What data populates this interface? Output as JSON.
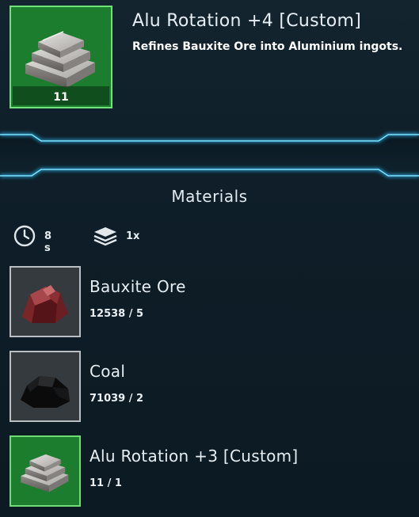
{
  "item": {
    "title": "Alu Rotation +4 [Custom]",
    "description": "Refines Bauxite Ore into Aluminium ingots.",
    "quantity": "11",
    "icon": "aluminium-ingots-icon",
    "frame_color": "#1d7d2f"
  },
  "materials": {
    "title": "Materials",
    "stats": {
      "time": "8 s",
      "time_icon": "clock-icon",
      "stack": "1x",
      "stack_icon": "layers-icon"
    },
    "items": [
      {
        "name": "Bauxite Ore",
        "count": "12538 / 5",
        "icon": "bauxite-ore-icon",
        "frame": "gray"
      },
      {
        "name": "Coal",
        "count": "71039 / 2",
        "icon": "coal-icon",
        "frame": "gray"
      },
      {
        "name": "Alu Rotation +3 [Custom]",
        "count": "11 / 1",
        "icon": "aluminium-ingots-icon",
        "frame": "green"
      }
    ]
  },
  "colors": {
    "accent_glow": "#2bc6ff",
    "rarity_green": "#1d7d2f",
    "background": "#0d1b25"
  }
}
